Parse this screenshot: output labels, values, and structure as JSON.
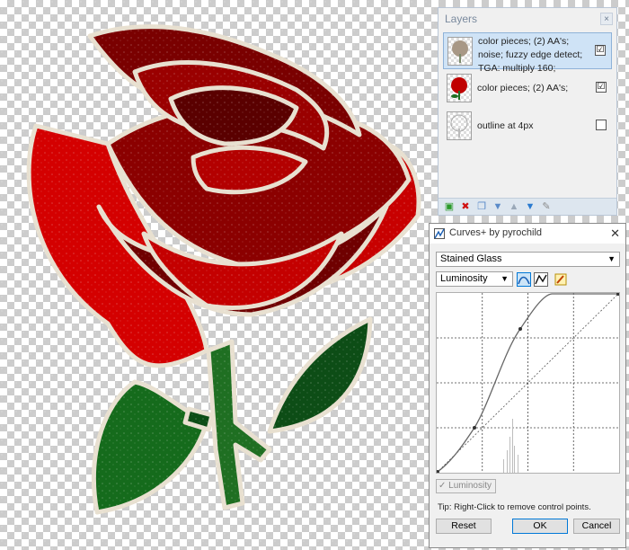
{
  "layers_panel": {
    "title": "Layers",
    "close_label": "×",
    "layers": [
      {
        "name": "color pieces; (2) AA's; noise; fuzzy edge detect; TGA: multiply 160;",
        "checked": "☑",
        "selected": true
      },
      {
        "name": "color pieces; (2) AA's;",
        "checked": "☑",
        "selected": false
      },
      {
        "name": "outline at 4px",
        "checked": "",
        "selected": false
      }
    ],
    "toolbar_icons": [
      "add-layer-icon",
      "delete-layer-icon",
      "duplicate-layer-icon",
      "merge-down-icon",
      "move-up-icon",
      "move-down-icon",
      "properties-icon"
    ]
  },
  "curves_dialog": {
    "title": "Curves+ by pyrochild",
    "close_label": "✕",
    "preset": "Stained Glass",
    "channel": "Luminosity",
    "luminosity_checkbox": "Luminosity",
    "tip": "Tip: Right-Click to remove control points.",
    "reset_label": "Reset",
    "ok_label": "OK",
    "cancel_label": "Cancel"
  },
  "colors": {
    "rose_dark": "#7a0000",
    "rose_bright": "#d40000",
    "leaf_dark": "#0c4a14",
    "leaf_bright": "#1c7a22",
    "outline": "#e8e0d0",
    "selection_blue": "#cfe3f6",
    "accent_blue": "#0078d7"
  }
}
